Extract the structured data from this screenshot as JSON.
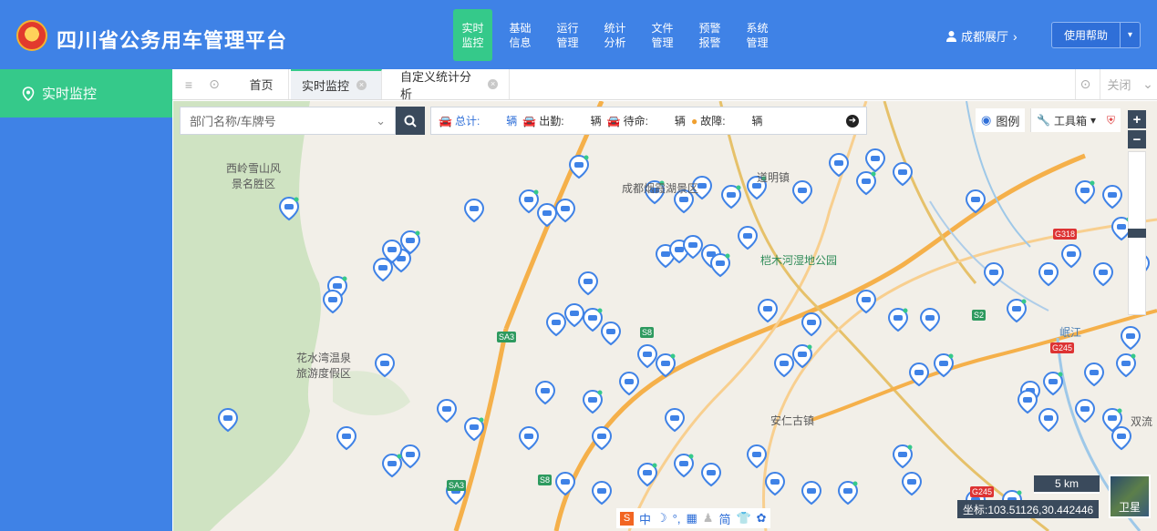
{
  "header": {
    "app_title": "四川省公务用车管理平台",
    "nav": [
      {
        "line1": "实时",
        "line2": "监控",
        "active": true
      },
      {
        "line1": "基础",
        "line2": "信息"
      },
      {
        "line1": "运行",
        "line2": "管理"
      },
      {
        "line1": "统计",
        "line2": "分析"
      },
      {
        "line1": "文件",
        "line2": "管理"
      },
      {
        "line1": "预警",
        "line2": "报警"
      },
      {
        "line1": "系统",
        "line2": "管理"
      }
    ],
    "user": "成都展厅",
    "help_label": "使用帮助"
  },
  "sidebar": {
    "items": [
      {
        "label": "实时监控"
      }
    ]
  },
  "tabs": {
    "items": [
      {
        "label": "首页"
      },
      {
        "label": "实时监控",
        "active": true
      },
      {
        "label": "自定义统计分析"
      }
    ],
    "close_label": "关闭"
  },
  "map": {
    "search_placeholder": "部门名称/车牌号",
    "stats": {
      "total_label": "总计:",
      "onduty_label": "出勤:",
      "standby_label": "待命:",
      "fault_label": "故障:",
      "unit": "辆"
    },
    "legend_label": "图例",
    "toolbox_label": "工具箱",
    "coords": "坐标:103.51126,30.442446",
    "scale": "5 km",
    "satellite_label": "卫星",
    "places": [
      "西岭雪山风景名胜区",
      "成都烟霞湖景区",
      "道明镇",
      "桤木河湿地公园",
      "花水湾温泉旅游度假区",
      "安仁古镇",
      "岷江",
      "双流"
    ],
    "roads": [
      "SA3",
      "S8",
      "G318",
      "G245",
      "SA3",
      "S8",
      "G245",
      "S2"
    ],
    "ime": [
      "中",
      "简"
    ],
    "colors": {
      "header": "#3f82e6",
      "accent": "#35c98a",
      "marker": "#3f82e6",
      "dark": "#3a4a5c"
    }
  }
}
